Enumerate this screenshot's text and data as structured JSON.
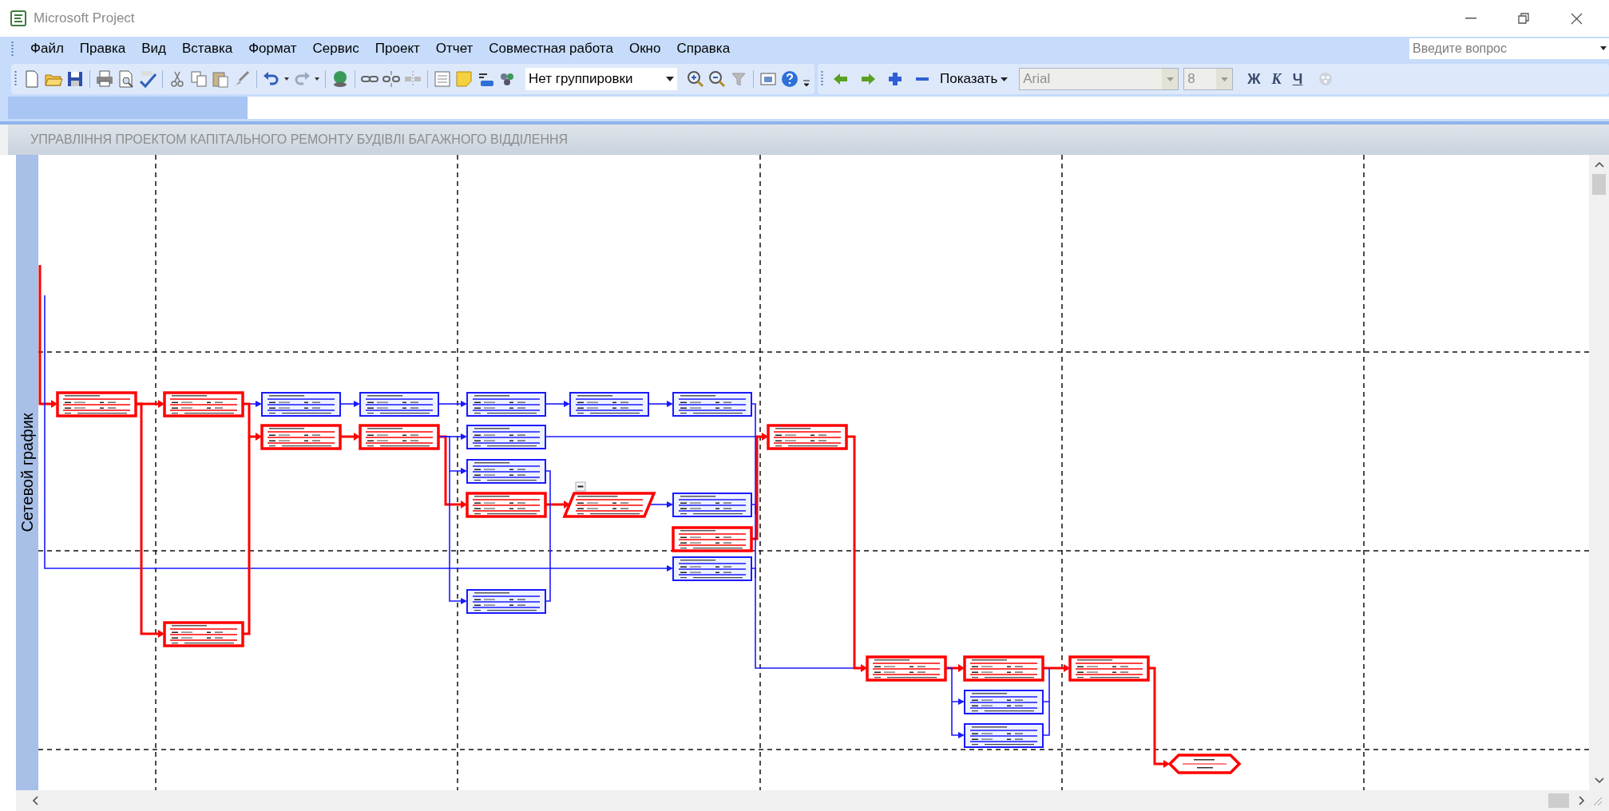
{
  "window": {
    "title": "Microsoft Project"
  },
  "menu": [
    "Файл",
    "Правка",
    "Вид",
    "Вставка",
    "Формат",
    "Сервис",
    "Проект",
    "Отчет",
    "Совместная работа",
    "Окно",
    "Справка"
  ],
  "help_box": {
    "placeholder": "Введите вопрос"
  },
  "toolbar": {
    "grouping": "Нет группировки",
    "show_menu": "Показать",
    "font": {
      "value": "Arial",
      "disabled": true
    },
    "font_size": {
      "value": "8",
      "disabled": true
    },
    "format_buttons": [
      "Ж",
      "К",
      "Ч"
    ]
  },
  "view": {
    "title": "УПРАВЛІННЯ ПРОЕКТОМ КАПІТАЛЬНОГО РЕМОНТУ БУДІВЛІ БАГАЖНОГО ВІДДІЛЕННЯ",
    "side_label": "Сетевой график"
  },
  "network_diagram": {
    "nodes": [
      {
        "kind": "task",
        "critical": true
      },
      {
        "kind": "task",
        "critical": true
      },
      {
        "kind": "task",
        "critical": false
      },
      {
        "kind": "task",
        "critical": false
      },
      {
        "kind": "task",
        "critical": false
      },
      {
        "kind": "task",
        "critical": false
      },
      {
        "kind": "task",
        "critical": false
      },
      {
        "kind": "task",
        "critical": true
      },
      {
        "kind": "task",
        "critical": true
      },
      {
        "kind": "task",
        "critical": false
      },
      {
        "kind": "task",
        "critical": true
      },
      {
        "kind": "task",
        "critical": false
      },
      {
        "kind": "task",
        "critical": true
      },
      {
        "kind": "summary",
        "critical": true,
        "expanded": true
      },
      {
        "kind": "task",
        "critical": false
      },
      {
        "kind": "task",
        "critical": true
      },
      {
        "kind": "task",
        "critical": false
      },
      {
        "kind": "task",
        "critical": false
      },
      {
        "kind": "task",
        "critical": true
      },
      {
        "kind": "task",
        "critical": true
      },
      {
        "kind": "task",
        "critical": true
      },
      {
        "kind": "task",
        "critical": true
      },
      {
        "kind": "task",
        "critical": false
      },
      {
        "kind": "task",
        "critical": false
      },
      {
        "kind": "milestone",
        "critical": true
      }
    ],
    "links": [
      {
        "critical": true
      },
      {
        "critical": false
      },
      {
        "critical": true
      },
      {
        "critical": true
      },
      {
        "critical": false
      },
      {
        "critical": true
      },
      {
        "critical": true
      },
      {
        "critical": false
      },
      {
        "critical": true
      },
      {
        "critical": false
      },
      {
        "critical": false
      },
      {
        "critical": true
      },
      {
        "critical": false
      },
      {
        "critical": false
      },
      {
        "critical": false
      },
      {
        "critical": false
      },
      {
        "critical": false
      },
      {
        "critical": true
      },
      {
        "critical": false
      },
      {
        "critical": false
      },
      {
        "critical": false
      },
      {
        "critical": true
      },
      {
        "critical": false
      },
      {
        "critical": false
      },
      {
        "critical": false
      },
      {
        "critical": true
      },
      {
        "critical": true
      },
      {
        "critical": false
      },
      {
        "critical": false
      },
      {
        "critical": true
      },
      {
        "critical": false
      },
      {
        "critical": false
      },
      {
        "critical": true
      }
    ]
  }
}
